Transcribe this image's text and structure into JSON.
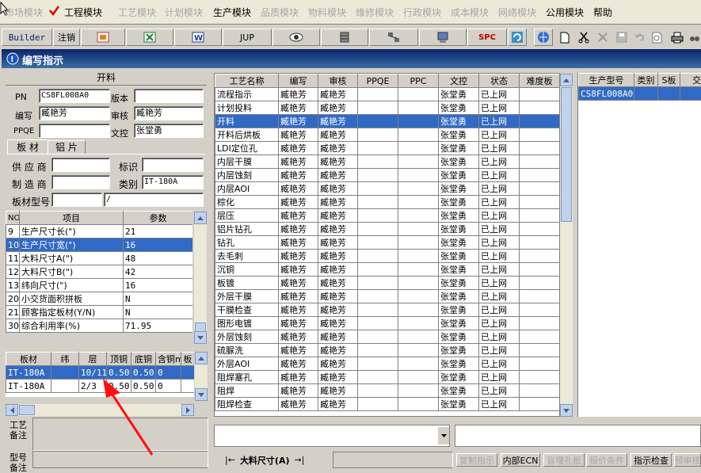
{
  "menu": {
    "items": [
      {
        "label": "市场模块",
        "disabled": true
      },
      {
        "label": "工程模块",
        "disabled": false,
        "checked": true
      },
      {
        "label": "工艺模块",
        "disabled": true
      },
      {
        "label": "计划模块",
        "disabled": true
      },
      {
        "label": "生产模块",
        "disabled": false
      },
      {
        "label": "品质模块",
        "disabled": true
      },
      {
        "label": "物料模块",
        "disabled": true
      },
      {
        "label": "维修模块",
        "disabled": true
      },
      {
        "label": "行政模块",
        "disabled": true
      },
      {
        "label": "成本模块",
        "disabled": true
      },
      {
        "label": "网络模块",
        "disabled": true
      },
      {
        "label": "公用模块",
        "disabled": false
      },
      {
        "label": "帮助",
        "disabled": false
      }
    ]
  },
  "toolbar": {
    "builder": "Builder",
    "logout": "注销",
    "jup": "JUP",
    "spc": "SPC"
  },
  "window": {
    "title": "编写指示"
  },
  "form": {
    "section": "开料",
    "pn_label": "PN",
    "pn": "CS8FL008A0",
    "version_label": "版本",
    "version": "",
    "author_label": "编写",
    "author": "臧艳芳",
    "review_label": "审核",
    "review": "臧艳芳",
    "ppqe_label": "PPQE",
    "ppqe": "",
    "control_label": "文控",
    "control": "张堂勇",
    "tab_board": "板 材",
    "tab_copper": "铝 片",
    "supplier_label": "供 应 商",
    "mark_label": "标识",
    "maker_label": "制 造 商",
    "type_label": "类别",
    "type": "IT-180A",
    "model_label": "板材型号",
    "model2": "/"
  },
  "params": {
    "headers": [
      "NO",
      "项目",
      "参数"
    ],
    "rows": [
      [
        "9",
        "生产尺寸长(\")",
        "21"
      ],
      [
        "10",
        "生产尺寸宽(\")",
        "16"
      ],
      [
        "11",
        "大料尺寸A(\")",
        "48"
      ],
      [
        "12",
        "大料尺寸B(\")",
        "42"
      ],
      [
        "13",
        "纬向尺寸(\")",
        "16"
      ],
      [
        "20",
        "小交货面积拼板",
        "N"
      ],
      [
        "21",
        "顾客指定板材(Y/N)",
        "N"
      ],
      [
        "30",
        "综合利用率(%)",
        "71.95"
      ]
    ],
    "selected": 1
  },
  "boards": {
    "headers": [
      "板材",
      "纬",
      "层",
      "顶铜",
      "底铜",
      "含铜mm",
      "板"
    ],
    "rows": [
      [
        "IT-180A",
        "",
        "10/11",
        "0.50",
        "0.50",
        "0",
        ""
      ],
      [
        "IT-180A",
        "",
        "2/3",
        "0.50",
        "0.50",
        "0",
        ""
      ]
    ]
  },
  "notes": {
    "process_label": "工艺备注",
    "model_label": "型号备注"
  },
  "process": {
    "headers": [
      "工艺名称",
      "编写",
      "审核",
      "PPQE",
      "PPC",
      "文控",
      "状态",
      "难度板"
    ],
    "rows": [
      [
        "流程指示",
        "臧艳芳",
        "臧艳芳",
        "",
        "",
        "张堂勇",
        "已上网",
        ""
      ],
      [
        "计划投料",
        "臧艳芳",
        "臧艳芳",
        "",
        "",
        "张堂勇",
        "已上网",
        ""
      ],
      [
        "开料",
        "臧艳芳",
        "臧艳芳",
        "",
        "",
        "张堂勇",
        "已上网",
        ""
      ],
      [
        "开料后烘板",
        "臧艳芳",
        "臧艳芳",
        "",
        "",
        "张堂勇",
        "已上网",
        ""
      ],
      [
        "LDI定位孔",
        "臧艳芳",
        "臧艳芳",
        "",
        "",
        "张堂勇",
        "已上网",
        ""
      ],
      [
        "内层干膜",
        "臧艳芳",
        "臧艳芳",
        "",
        "",
        "张堂勇",
        "已上网",
        ""
      ],
      [
        "内层蚀刻",
        "臧艳芳",
        "臧艳芳",
        "",
        "",
        "张堂勇",
        "已上网",
        ""
      ],
      [
        "内层AOI",
        "臧艳芳",
        "臧艳芳",
        "",
        "",
        "张堂勇",
        "已上网",
        ""
      ],
      [
        "棕化",
        "臧艳芳",
        "臧艳芳",
        "",
        "",
        "张堂勇",
        "已上网",
        ""
      ],
      [
        "层压",
        "臧艳芳",
        "臧艳芳",
        "",
        "",
        "张堂勇",
        "已上网",
        ""
      ],
      [
        "铝片钻孔",
        "臧艳芳",
        "臧艳芳",
        "",
        "",
        "张堂勇",
        "已上网",
        ""
      ],
      [
        "钻孔",
        "臧艳芳",
        "臧艳芳",
        "",
        "",
        "张堂勇",
        "已上网",
        ""
      ],
      [
        "去毛刺",
        "臧艳芳",
        "臧艳芳",
        "",
        "",
        "张堂勇",
        "已上网",
        ""
      ],
      [
        "沉铜",
        "臧艳芳",
        "臧艳芳",
        "",
        "",
        "张堂勇",
        "已上网",
        ""
      ],
      [
        "板镀",
        "臧艳芳",
        "臧艳芳",
        "",
        "",
        "张堂勇",
        "已上网",
        ""
      ],
      [
        "外层干膜",
        "臧艳芳",
        "臧艳芳",
        "",
        "",
        "张堂勇",
        "已上网",
        ""
      ],
      [
        "干膜检查",
        "臧艳芳",
        "臧艳芳",
        "",
        "",
        "张堂勇",
        "已上网",
        ""
      ],
      [
        "图形电镀",
        "臧艳芳",
        "臧艳芳",
        "",
        "",
        "张堂勇",
        "已上网",
        ""
      ],
      [
        "外层蚀刻",
        "臧艳芳",
        "臧艳芳",
        "",
        "",
        "张堂勇",
        "已上网",
        ""
      ],
      [
        "硫脲洗",
        "臧艳芳",
        "臧艳芳",
        "",
        "",
        "张堂勇",
        "已上网",
        ""
      ],
      [
        "外层AOI",
        "臧艳芳",
        "臧艳芳",
        "",
        "",
        "张堂勇",
        "已上网",
        ""
      ],
      [
        "阻焊塞孔",
        "臧艳芳",
        "臧艳芳",
        "",
        "",
        "张堂勇",
        "已上网",
        ""
      ],
      [
        "阻焊",
        "臧艳芳",
        "臧艳芳",
        "",
        "",
        "张堂勇",
        "已上网",
        ""
      ],
      [
        "阻焊检查",
        "臧艳芳",
        "臧艳芳",
        "",
        "",
        "张堂勇",
        "已上网",
        ""
      ]
    ],
    "selected": 2
  },
  "right_grid": {
    "headers": [
      "生产型号",
      "类别",
      "S板",
      "交"
    ],
    "rows": [
      [
        "CS8FL008A0",
        "",
        "",
        ""
      ]
    ]
  },
  "bottom": {
    "nav_label": "大料尺寸(A)",
    "buttons": [
      "复制指示",
      "内部ECN",
      "盲埋孔板",
      "报价条件",
      "指示检查",
      "预审核"
    ],
    "disabled": [
      true,
      false,
      true,
      true,
      false,
      true
    ]
  },
  "colors": {
    "selection": "#316ac5",
    "title_start": "#0a246a",
    "annotation_arrow": "#ff0000"
  }
}
